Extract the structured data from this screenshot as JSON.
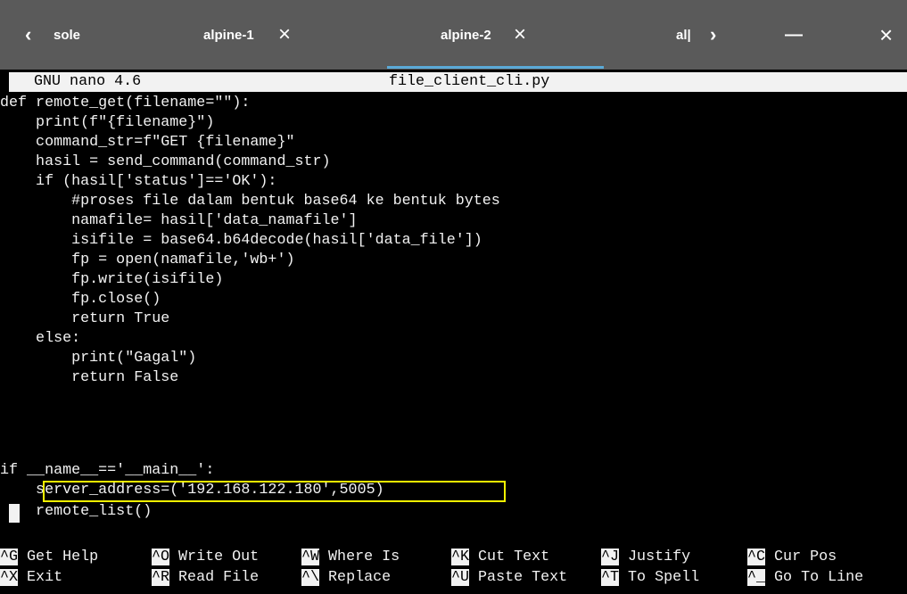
{
  "tabbar": {
    "tabs": [
      {
        "label": "sole"
      },
      {
        "label": "alpine-1"
      },
      {
        "label": "alpine-2"
      },
      {
        "label": "al|"
      }
    ],
    "close_glyph": "×",
    "left_arrow": "‹",
    "right_arrow": "›",
    "minimize_glyph": "—",
    "window_close_glyph": "×",
    "accent_color": "#5aa9d6"
  },
  "nano": {
    "version": "GNU nano 4.6",
    "filename": "file_client_cli.py"
  },
  "code_lines": [
    "def remote_get(filename=\"\"):",
    "    print(f\"{filename}\")",
    "    command_str=f\"GET {filename}\"",
    "    hasil = send_command(command_str)",
    "    if (hasil['status']=='OK'):",
    "        #proses file dalam bentuk base64 ke bentuk bytes",
    "        namafile= hasil['data_namafile']",
    "        isifile = base64.b64decode(hasil['data_file'])",
    "        fp = open(namafile,'wb+')",
    "        fp.write(isifile)",
    "        fp.close()",
    "        return True",
    "    else:",
    "        print(\"Gagal\")",
    "        return False",
    "",
    "",
    "if __name__=='__main__':",
    "    server_address=('192.168.122.180',5005)",
    "    remote_list()"
  ],
  "shortcuts_row1": [
    {
      "key": "^G",
      "label": "Get Help"
    },
    {
      "key": "^O",
      "label": "Write Out"
    },
    {
      "key": "^W",
      "label": "Where Is"
    },
    {
      "key": "^K",
      "label": "Cut Text"
    },
    {
      "key": "^J",
      "label": "Justify"
    },
    {
      "key": "^C",
      "label": "Cur Pos"
    }
  ],
  "shortcuts_row2": [
    {
      "key": "^X",
      "label": "Exit"
    },
    {
      "key": "^R",
      "label": "Read File"
    },
    {
      "key": "^\\",
      "label": "Replace"
    },
    {
      "key": "^U",
      "label": "Paste Text"
    },
    {
      "key": "^T",
      "label": "To Spell"
    },
    {
      "key": "^_",
      "label": "Go To Line"
    }
  ],
  "colors": {
    "terminal_bg": "#000000",
    "terminal_fg": "#f2f2f2",
    "tabbar_bg": "#5a5a5a",
    "highlight": "#f5f500"
  }
}
